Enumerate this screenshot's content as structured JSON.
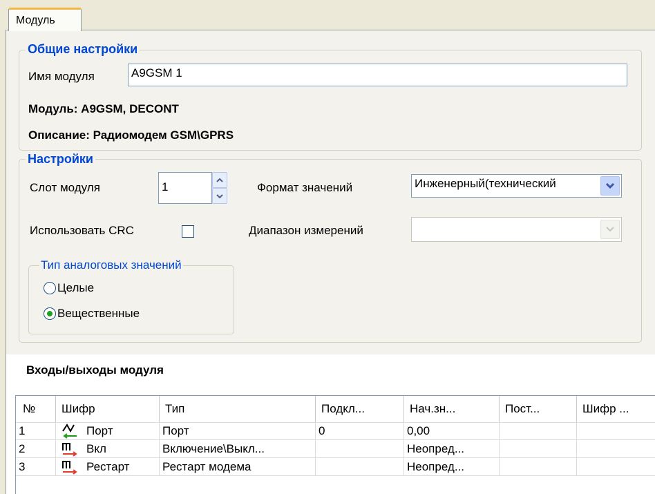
{
  "tabs": [
    {
      "label": "Модуль"
    }
  ],
  "general": {
    "title": "Общие настройки",
    "name_label": "Имя модуля",
    "name_value": "A9GSM 1",
    "module_line": "Модуль: A9GSM, DECONT",
    "description_line": "Описание: Радиомодем GSM\\GPRS"
  },
  "settings": {
    "title": "Настройки",
    "slot_label": "Слот модуля",
    "slot_value": "1",
    "format_label": "Формат значений",
    "format_value": "Инженерный(технический",
    "crc_label": "Использовать CRC",
    "crc_checked": false,
    "range_label": "Диапазон измерений",
    "range_value": "",
    "analog_group": {
      "title": "Тип аналоговых значений",
      "options": [
        {
          "label": "Целые",
          "selected": false
        },
        {
          "label": "Вещественные",
          "selected": true
        }
      ]
    }
  },
  "io": {
    "title": "Входы/выходы модуля",
    "columns": [
      "№",
      "Шифр",
      "Тип",
      "Подкл...",
      "Нач.зн...",
      "Пост...",
      "Шифр ..."
    ],
    "rows": [
      {
        "num": "1",
        "icon": "analog-signal-icon",
        "code": "Порт",
        "type": "Порт",
        "conn": "0",
        "init": "0,00",
        "const": "",
        "code2": ""
      },
      {
        "num": "2",
        "icon": "digital-output-icon",
        "code": "Вкл",
        "type": "Включение\\Выкл...",
        "conn": "",
        "init": "Неопред...",
        "const": "",
        "code2": ""
      },
      {
        "num": "3",
        "icon": "digital-output-icon",
        "code": "Рестарт",
        "type": "Рестарт модема",
        "conn": "",
        "init": "Неопред...",
        "const": "",
        "code2": ""
      }
    ]
  },
  "colors": {
    "group_title": "#0046d5",
    "tab_highlight": "#f0b545",
    "radio_dot": "#21a121"
  }
}
